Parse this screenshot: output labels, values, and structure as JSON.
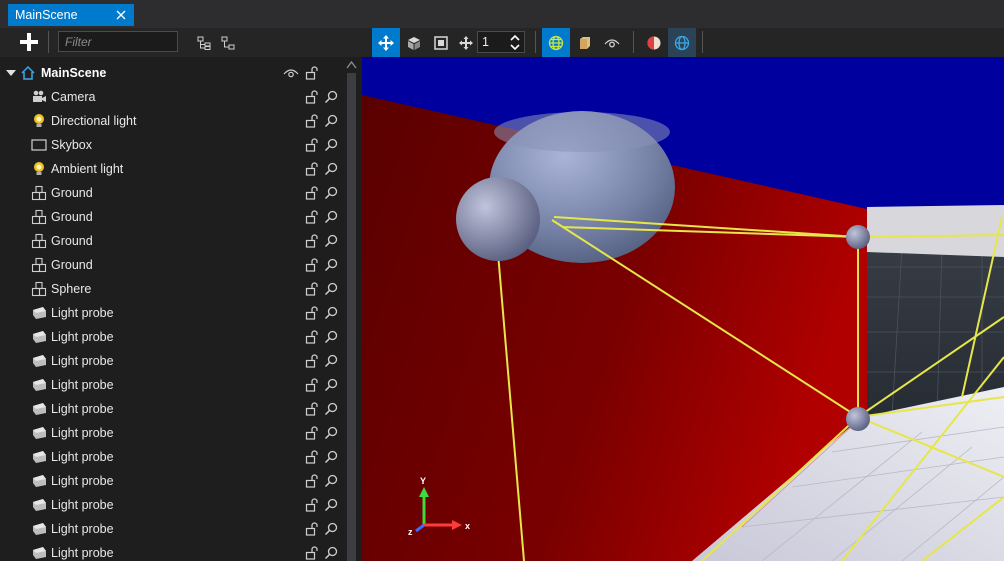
{
  "tab": {
    "title": "MainScene",
    "close_icon": "close-icon"
  },
  "toolbar": {
    "filter_placeholder": "Filter",
    "snap_value": "1",
    "accent": "#007acc"
  },
  "hierarchy": {
    "root": {
      "label": "MainScene"
    },
    "items": [
      {
        "label": "Camera",
        "icon": "camera-icon"
      },
      {
        "label": "Directional light",
        "icon": "light-bulb-icon"
      },
      {
        "label": "Skybox",
        "icon": "skybox-icon"
      },
      {
        "label": "Ambient light",
        "icon": "light-bulb-icon"
      },
      {
        "label": "Ground",
        "icon": "entity-icon"
      },
      {
        "label": "Ground",
        "icon": "entity-icon"
      },
      {
        "label": "Ground",
        "icon": "entity-icon"
      },
      {
        "label": "Ground",
        "icon": "entity-icon"
      },
      {
        "label": "Sphere",
        "icon": "entity-icon"
      },
      {
        "label": "Light probe",
        "icon": "light-probe-icon"
      },
      {
        "label": "Light probe",
        "icon": "light-probe-icon"
      },
      {
        "label": "Light probe",
        "icon": "light-probe-icon"
      },
      {
        "label": "Light probe",
        "icon": "light-probe-icon"
      },
      {
        "label": "Light probe",
        "icon": "light-probe-icon"
      },
      {
        "label": "Light probe",
        "icon": "light-probe-icon"
      },
      {
        "label": "Light probe",
        "icon": "light-probe-icon"
      },
      {
        "label": "Light probe",
        "icon": "light-probe-icon"
      },
      {
        "label": "Light probe",
        "icon": "light-probe-icon"
      },
      {
        "label": "Light probe",
        "icon": "light-probe-icon"
      },
      {
        "label": "Light probe",
        "icon": "light-probe-icon"
      }
    ]
  },
  "gizmo": {
    "x": "x",
    "y": "Y",
    "z": "z"
  },
  "colors": {
    "sky": "#0000a6",
    "wall": "#8a0000",
    "probe_lines": "#e6e64a",
    "x_axis": "#ff3b3b",
    "y_axis": "#3bdc3b",
    "z_axis": "#3b6bff"
  }
}
